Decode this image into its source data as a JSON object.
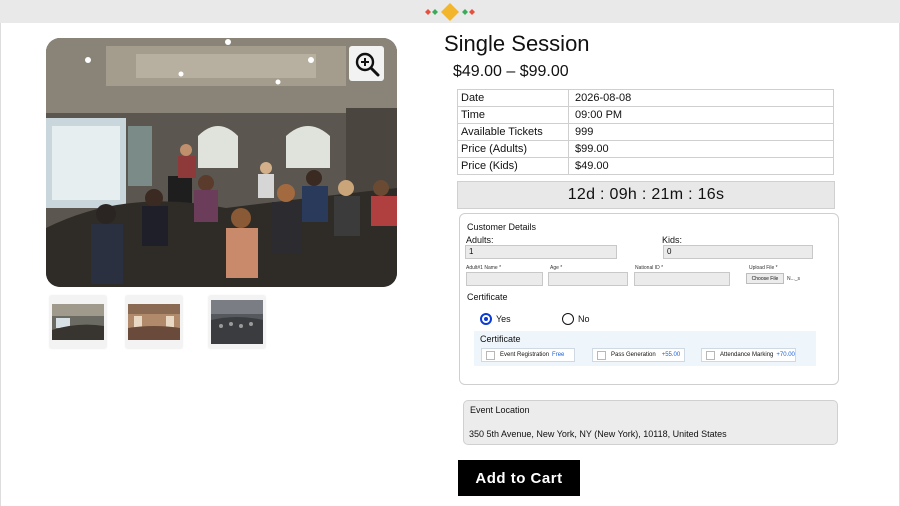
{
  "product": {
    "title": "Single Session",
    "price_range": "$49.00 – $99.00"
  },
  "icons": {
    "zoom": "zoom-in-icon",
    "logo": "four-diamond-logo"
  },
  "thumbnails": [
    "conference-room-thumbnail",
    "venue-hall-thumbnail",
    "audience-thumbnail"
  ],
  "event_details": [
    {
      "label": "Date",
      "value": "2026-08-08"
    },
    {
      "label": "Time",
      "value": "09:00 PM"
    },
    {
      "label": "Available Tickets",
      "value": "999"
    },
    {
      "label": "Price (Adults)",
      "value": "$99.00"
    },
    {
      "label": "Price (Kids)",
      "value": "$49.00"
    }
  ],
  "countdown": "12d : 09h : 21m : 16s",
  "customer": {
    "heading": "Customer Details",
    "adults_label": "Adults:",
    "adults_value": "1",
    "kids_label": "Kids:",
    "kids_value": "0",
    "fields": {
      "name_label": "Adult#1 Name *",
      "age_label": "Age *",
      "national_id_label": "National ID *",
      "upload_label": "Upload File *",
      "choose_file": "Choose File",
      "no_file": "N..._s"
    }
  },
  "certificate": {
    "label": "Certificate",
    "yes": "Yes",
    "no": "No",
    "selected": "Yes",
    "panel_title": "Certificate",
    "options": [
      {
        "label": "Event Registration",
        "extra": "Free"
      },
      {
        "label": "Pass Generation",
        "extra": "+55.00"
      },
      {
        "label": "Attendance Marking",
        "extra": "+70.00"
      }
    ]
  },
  "location": {
    "heading": "Event Location",
    "address": "350 5th Avenue, New York, NY (New York), 10118, United States"
  },
  "cart": {
    "button": "Add to Cart"
  },
  "colors": {
    "accent_blue": "#0b3bd4",
    "button_black": "#000000",
    "logo_green": "#3bab5a",
    "logo_red": "#e5503f",
    "logo_gold": "#f2b52c"
  }
}
